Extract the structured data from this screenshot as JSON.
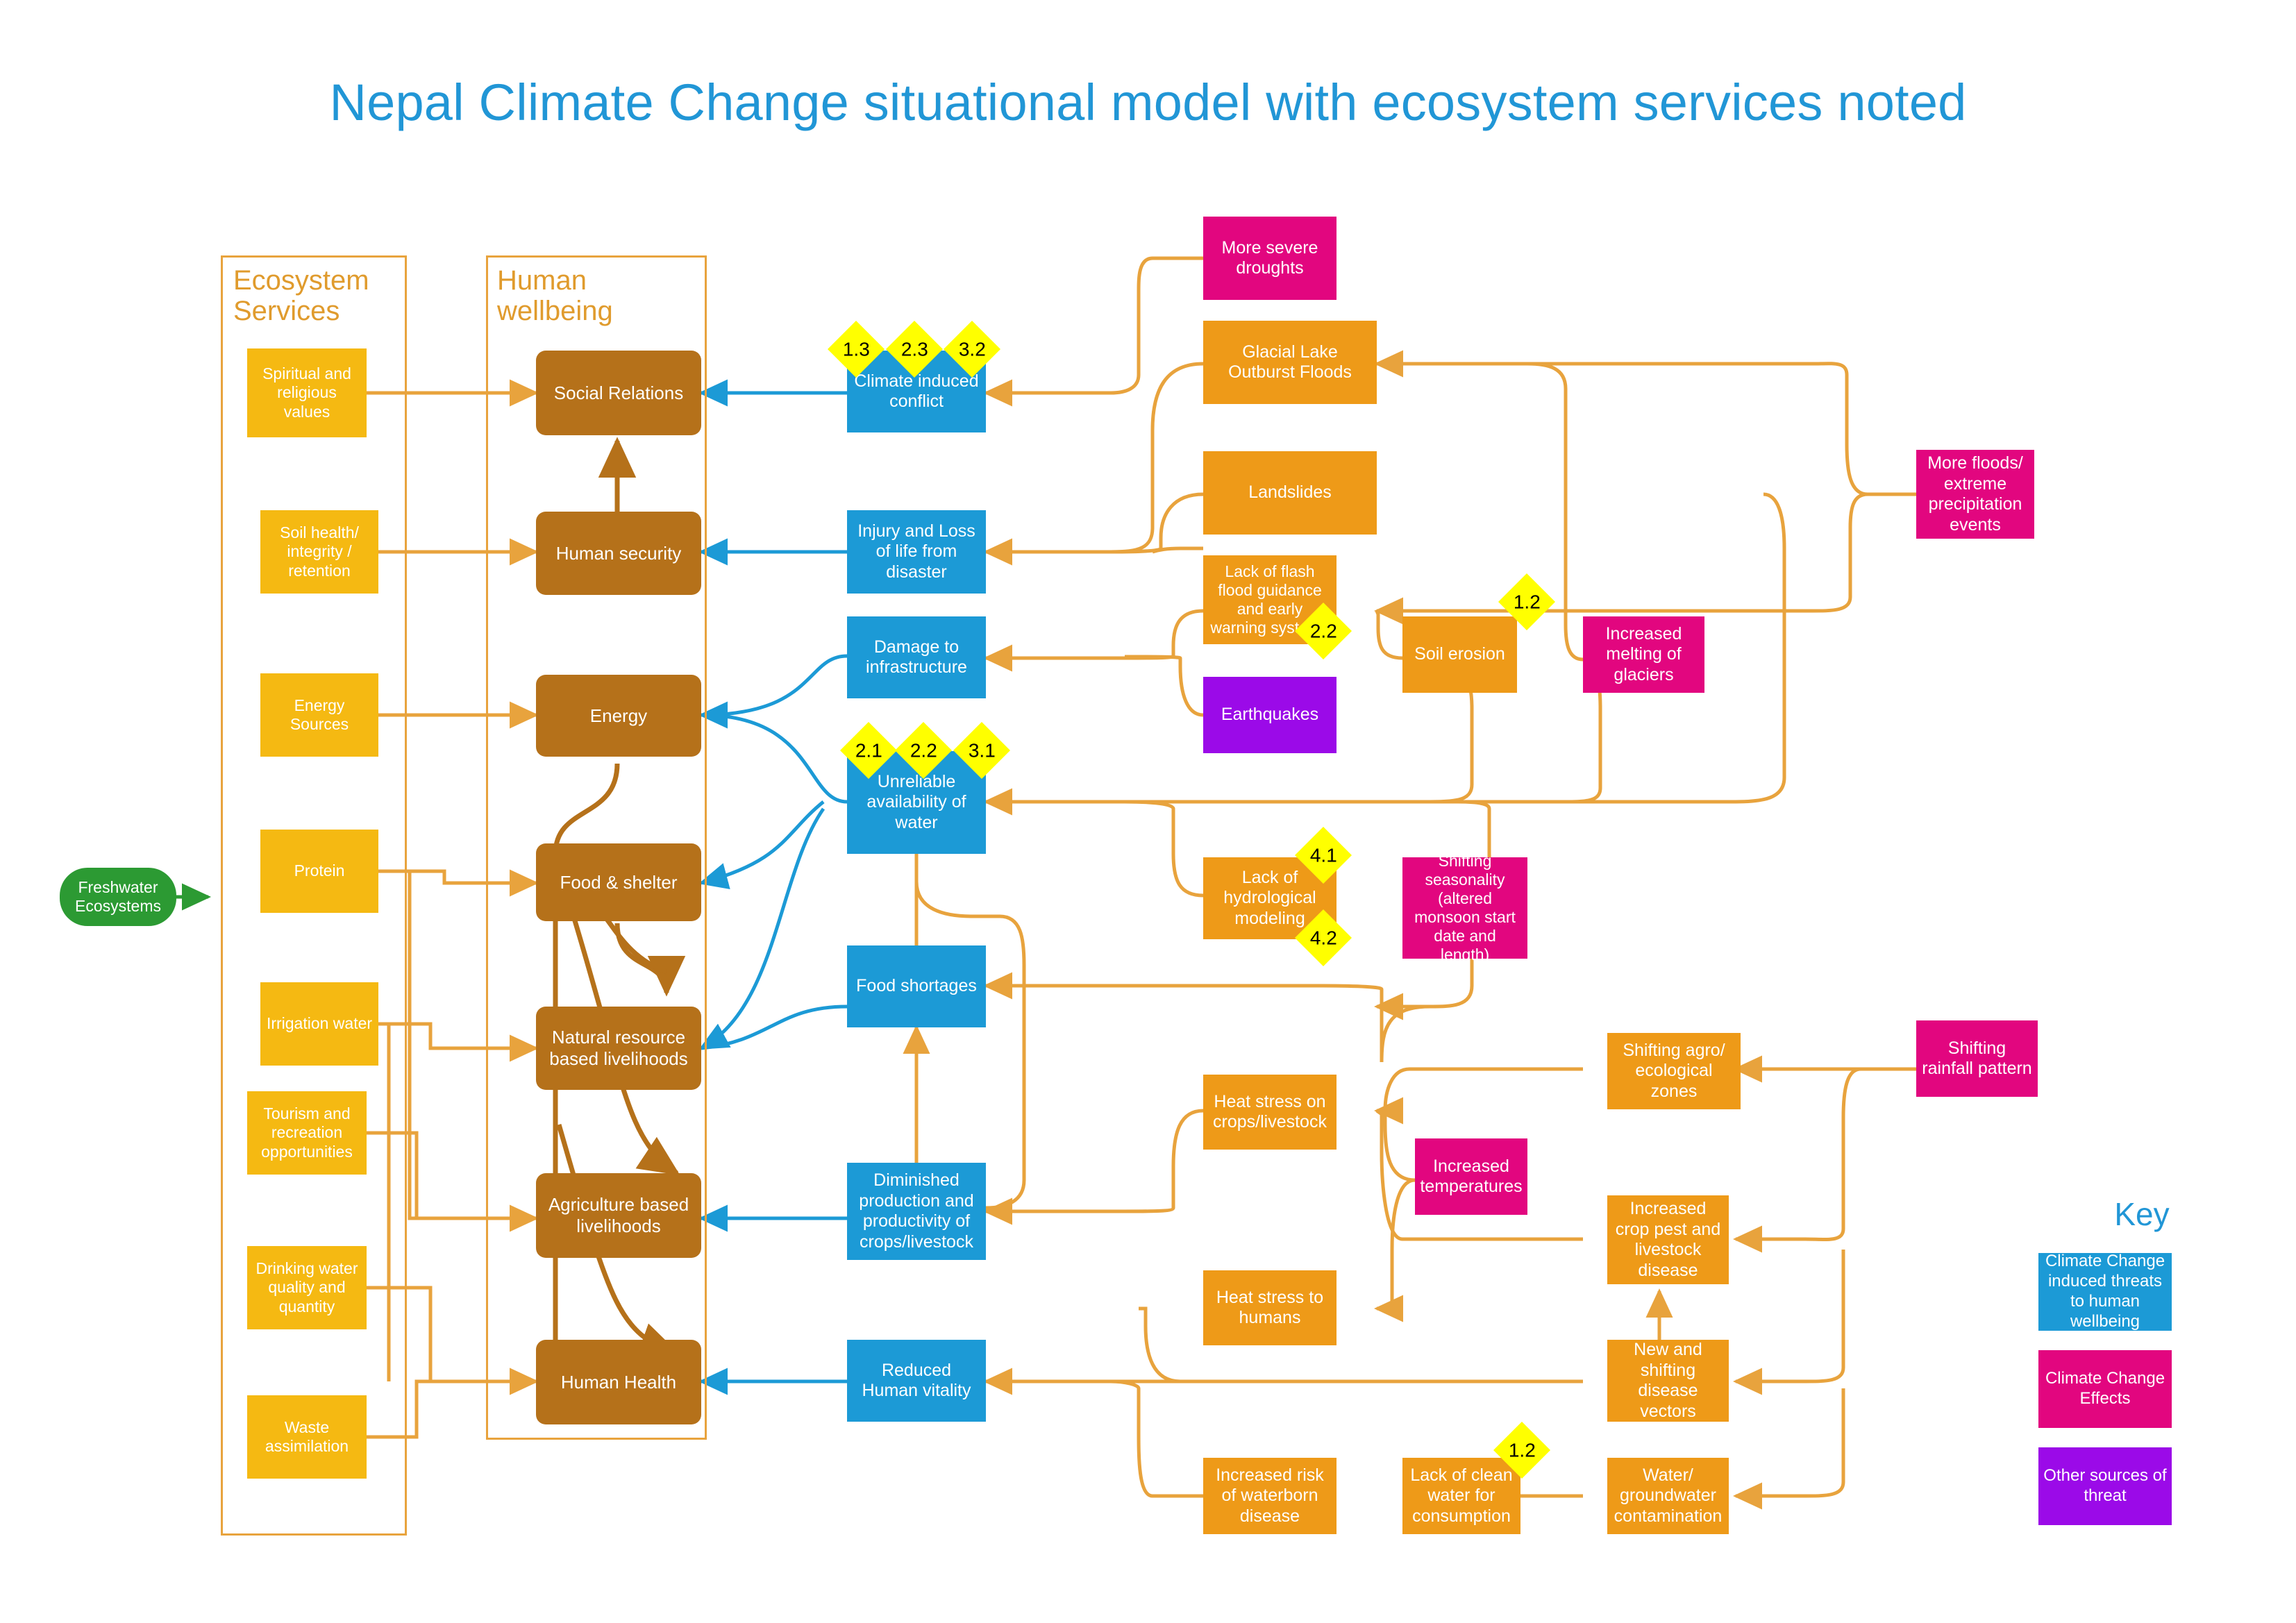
{
  "page": {
    "title": "Nepal Climate Change situational model with ecosystem services noted"
  },
  "groups": {
    "ecosystem_services": {
      "title": "Ecosystem\nServices"
    },
    "human_wellbeing": {
      "title": "Human\nwellbeing"
    }
  },
  "colors": {
    "title_blue": "#2196d6",
    "ecosystem_service_yellow": "#F5B912",
    "human_wellbeing_brown": "#B5711A",
    "climate_threat_blue": "#1C9AD6",
    "effect_orange": "#EE9A18",
    "climate_effect_pink": "#E2067F",
    "other_threat_purple": "#9B0AE8",
    "freshwater_green": "#2C9A33",
    "badge_yellow": "#FFFF00",
    "group_border_orange": "#E8A33D"
  },
  "source_node": {
    "label": "Freshwater Ecosystems"
  },
  "ecosystem_services": [
    {
      "label": "Spiritual and religious values"
    },
    {
      "label": "Soil health/ integrity / retention"
    },
    {
      "label": "Energy Sources"
    },
    {
      "label": "Protein"
    },
    {
      "label": "Irrigation water"
    },
    {
      "label": "Tourism and recreation opportunities"
    },
    {
      "label": "Drinking water quality and quantity"
    },
    {
      "label": "Waste assimilation"
    }
  ],
  "human_wellbeing": [
    {
      "label": "Social Relations"
    },
    {
      "label": "Human security"
    },
    {
      "label": "Energy"
    },
    {
      "label": "Food & shelter"
    },
    {
      "label": "Natural resource based livelihoods"
    },
    {
      "label": "Agriculture based livelihoods"
    },
    {
      "label": "Human Health"
    }
  ],
  "climate_threats": [
    {
      "label": "Climate induced conflict",
      "badges": [
        "1.3",
        "2.3",
        "3.2"
      ]
    },
    {
      "label": "Injury and Loss of life from disaster",
      "badges": []
    },
    {
      "label": "Damage to infrastructure",
      "badges": []
    },
    {
      "label": "Unreliable availability of water",
      "badges": [
        "2.1",
        "2.2",
        "3.1"
      ]
    },
    {
      "label": "Food shortages",
      "badges": []
    },
    {
      "label": "Diminished production and productivity of crops/livestock",
      "badges": []
    },
    {
      "label": "Reduced Human vitality",
      "badges": []
    }
  ],
  "effects": [
    {
      "label": "More severe droughts",
      "type": "climate_effect"
    },
    {
      "label": "Glacial Lake Outburst Floods",
      "type": "effect"
    },
    {
      "label": "Landslides",
      "type": "effect"
    },
    {
      "label": "Lack of flash flood guidance and early warning systems",
      "type": "effect",
      "badge": "2.2"
    },
    {
      "label": "Earthquakes",
      "type": "other_threat"
    },
    {
      "label": "Soil erosion",
      "type": "effect",
      "badge": "1.2"
    },
    {
      "label": "Increased melting of glaciers",
      "type": "climate_effect"
    },
    {
      "label": "More floods/ extreme precipitation events",
      "type": "climate_effect"
    },
    {
      "label": "Lack of hydrological modeling",
      "type": "effect",
      "badges": [
        "4.1",
        "4.2"
      ]
    },
    {
      "label": "Shifting seasonality (altered monsoon start date and length)",
      "type": "climate_effect"
    },
    {
      "label": "Heat stress on crops/livestock",
      "type": "effect"
    },
    {
      "label": "Shifting agro/ ecological zones",
      "type": "effect"
    },
    {
      "label": "Shifting rainfall pattern",
      "type": "climate_effect"
    },
    {
      "label": "Increased temperatures",
      "type": "climate_effect"
    },
    {
      "label": "Increased crop pest and livestock disease",
      "type": "effect"
    },
    {
      "label": "Heat stress to humans",
      "type": "effect"
    },
    {
      "label": "New and shifting disease vectors",
      "type": "effect"
    },
    {
      "label": "Increased risk of waterborn disease",
      "type": "effect"
    },
    {
      "label": "Lack of clean water for consumption",
      "type": "effect",
      "badge": "1.2"
    },
    {
      "label": "Water/ groundwater contamination",
      "type": "effect"
    }
  ],
  "key": {
    "title": "Key",
    "items": [
      {
        "label": "Climate Change induced threats to human wellbeing",
        "color": "#1C9AD6"
      },
      {
        "label": "Climate Change Effects",
        "color": "#E2067F"
      },
      {
        "label": "Other sources of threat",
        "color": "#9B0AE8"
      }
    ]
  }
}
